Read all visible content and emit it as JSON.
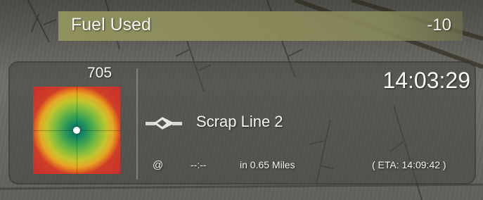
{
  "fuel": {
    "label": "Fuel Used",
    "value": "-10"
  },
  "panel": {
    "score": "705",
    "clock": "14:03:29",
    "track_name": "Scrap Line 2",
    "at_symbol": "@",
    "time_placeholder": "--:--",
    "distance": "in 0.65 Miles",
    "eta": "( ETA:  14:09:42  )"
  },
  "icons": {
    "track": "track-junction-icon",
    "radar": "radar-target-icon"
  },
  "colors": {
    "fuel_bar": "#96965f",
    "radar_center": "#0d6f55",
    "radar_outer": "#c42e2e",
    "text": "#f4f4f0"
  }
}
